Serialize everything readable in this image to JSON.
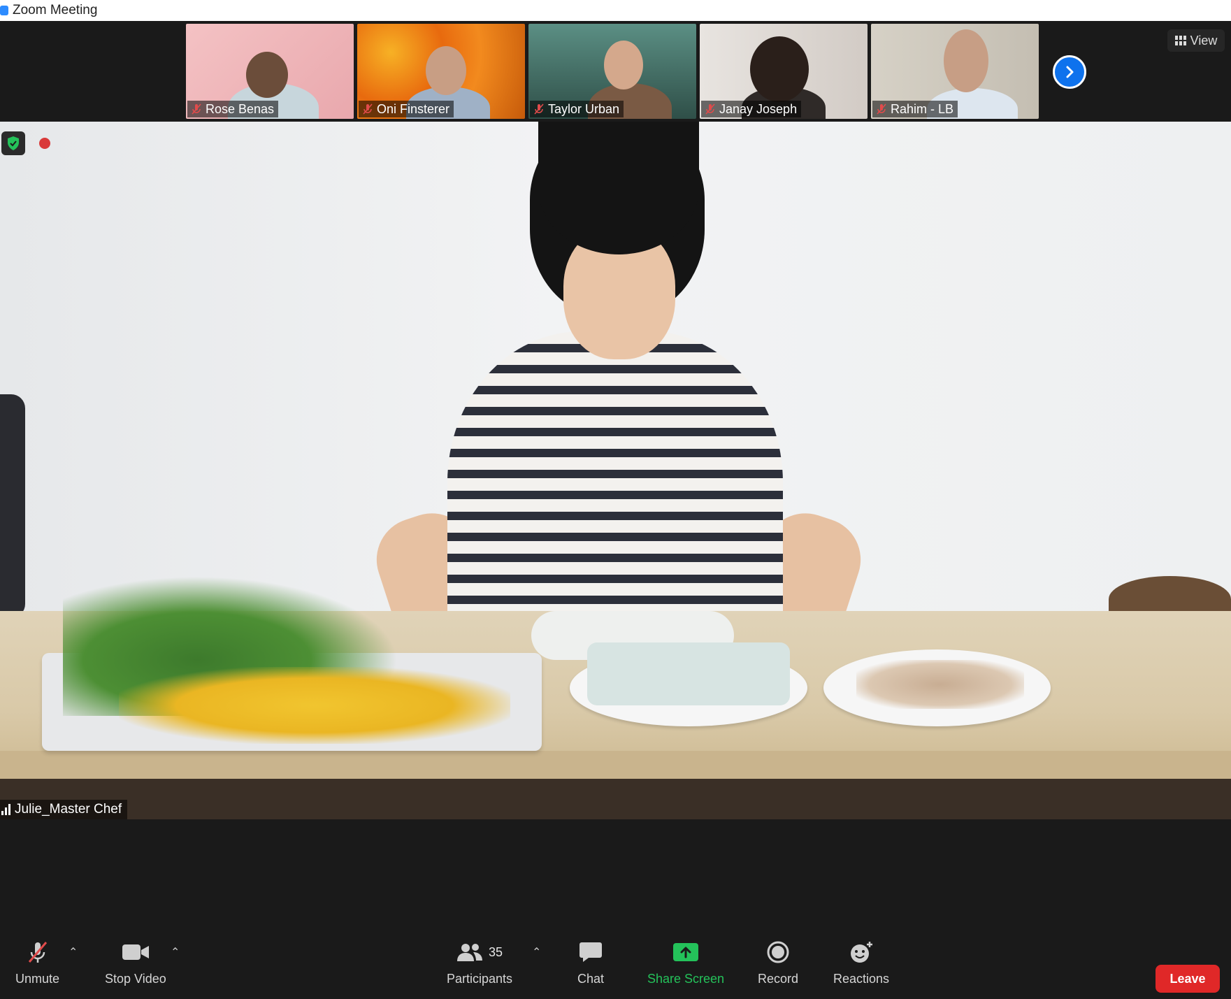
{
  "window": {
    "title": "Zoom Meeting"
  },
  "filmstrip": {
    "participants": [
      {
        "name": "Rose Benas",
        "bg": "#f1b5b9"
      },
      {
        "name": "Oni Finsterer",
        "bg": "#f28a1e"
      },
      {
        "name": "Taylor Urban",
        "bg": "#3f6b60"
      },
      {
        "name": "Janay Joseph",
        "bg": "#d8d1cc"
      },
      {
        "name": "Rahim - LB",
        "bg": "#cfc9bd"
      }
    ],
    "view_label": "View"
  },
  "main": {
    "speaker_name": "Julie_Master Chef"
  },
  "toolbar": {
    "unmute": "Unmute",
    "stop_video": "Stop Video",
    "participants": "Participants",
    "participant_count": "35",
    "chat": "Chat",
    "share_screen": "Share Screen",
    "record": "Record",
    "reactions": "Reactions",
    "leave": "Leave"
  },
  "colors": {
    "accent": "#0e72ed",
    "share": "#24c25a",
    "leave": "#e02828"
  }
}
